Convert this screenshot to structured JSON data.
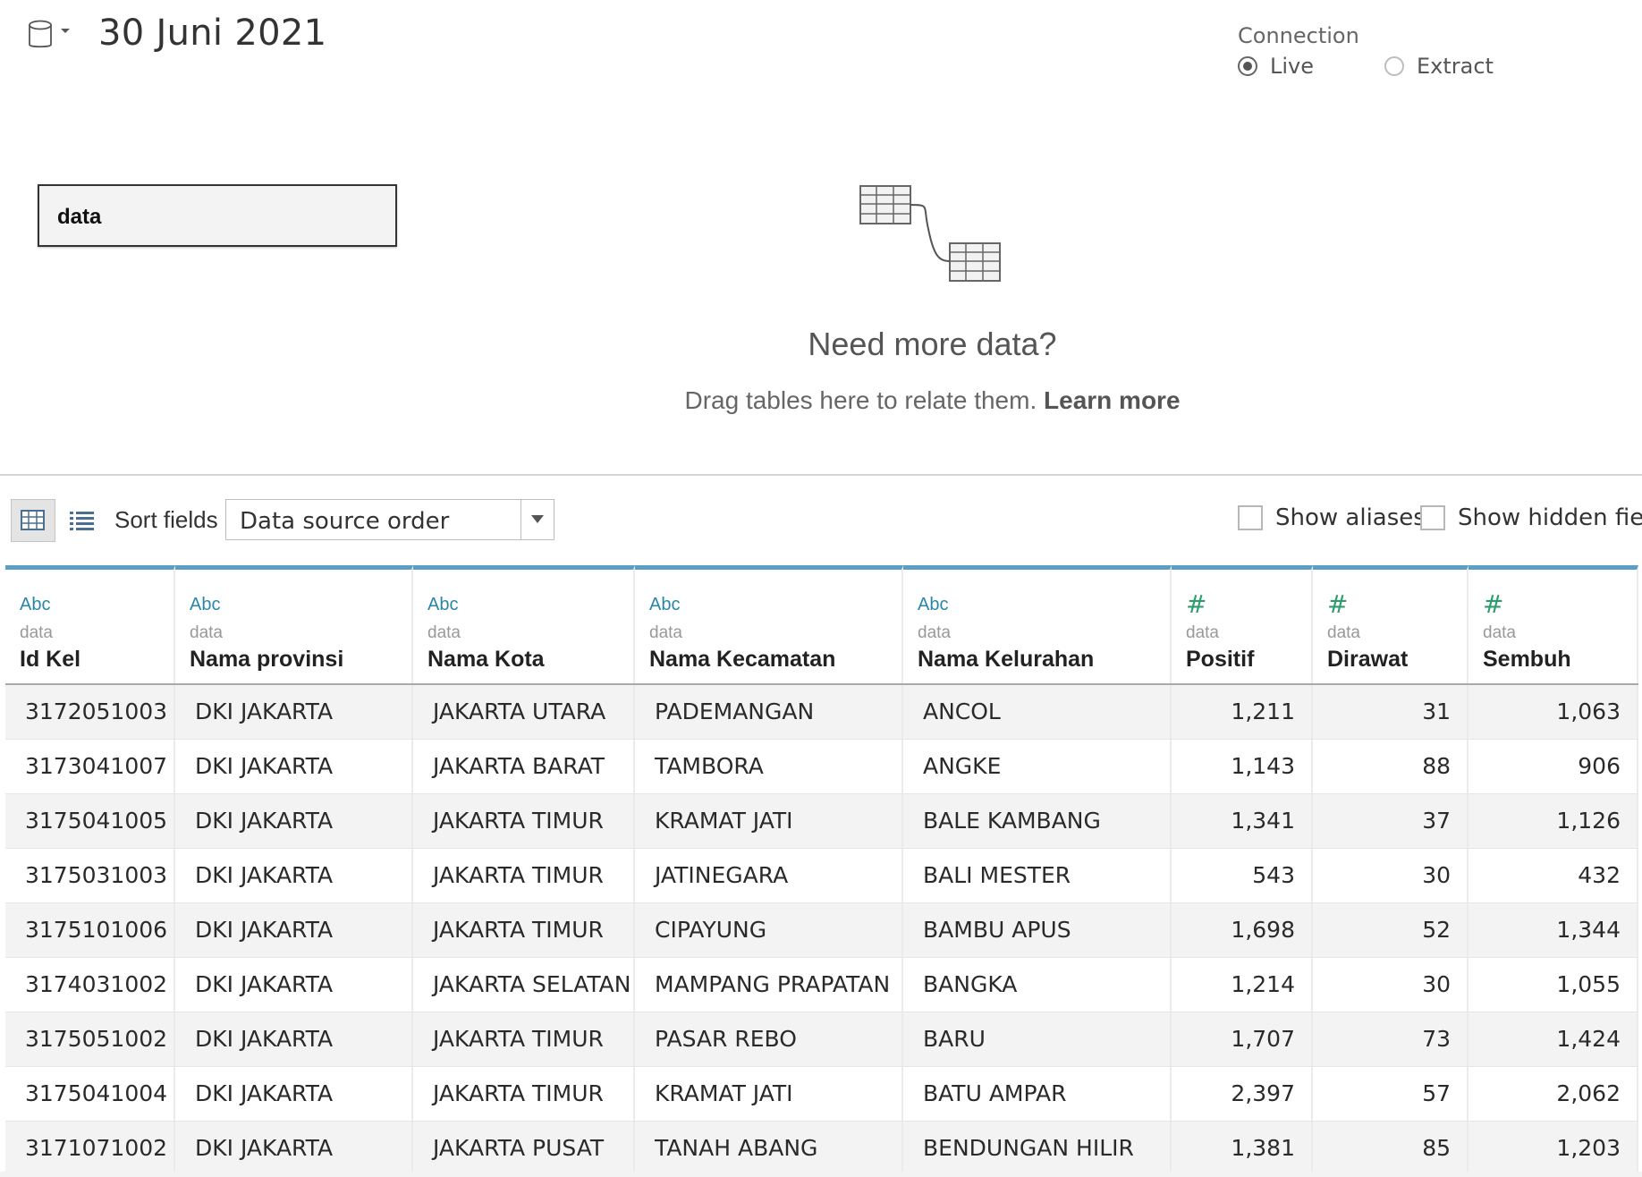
{
  "datasource": {
    "title": "30 Juni 2021",
    "icon": "database-icon"
  },
  "connection": {
    "label": "Connection",
    "options": [
      {
        "label": "Live",
        "selected": true
      },
      {
        "label": "Extract",
        "selected": false
      }
    ]
  },
  "canvas": {
    "table_name": "data",
    "need_more_title": "Need more data?",
    "need_more_text": "Drag tables here to relate them.",
    "learn_more": "Learn more"
  },
  "toolbar": {
    "sort_label": "Sort fields",
    "sort_value": "Data source order",
    "show_aliases": "Show aliases",
    "show_hidden": "Show hidden fields"
  },
  "grid": {
    "columns": [
      {
        "type": "Abc",
        "source": "data",
        "name": "Id Kel"
      },
      {
        "type": "Abc",
        "source": "data",
        "name": "Nama provinsi"
      },
      {
        "type": "Abc",
        "source": "data",
        "name": "Nama Kota"
      },
      {
        "type": "Abc",
        "source": "data",
        "name": "Nama Kecamatan"
      },
      {
        "type": "Abc",
        "source": "data",
        "name": "Nama Kelurahan"
      },
      {
        "type": "#",
        "source": "data",
        "name": "Positif"
      },
      {
        "type": "#",
        "source": "data",
        "name": "Dirawat"
      },
      {
        "type": "#",
        "source": "data",
        "name": "Sembuh"
      }
    ],
    "rows": [
      [
        "3172051003",
        "DKI JAKARTA",
        "JAKARTA UTARA",
        "PADEMANGAN",
        "ANCOL",
        "1,211",
        "31",
        "1,063"
      ],
      [
        "3173041007",
        "DKI JAKARTA",
        "JAKARTA BARAT",
        "TAMBORA",
        "ANGKE",
        "1,143",
        "88",
        "906"
      ],
      [
        "3175041005",
        "DKI JAKARTA",
        "JAKARTA TIMUR",
        "KRAMAT JATI",
        "BALE KAMBANG",
        "1,341",
        "37",
        "1,126"
      ],
      [
        "3175031003",
        "DKI JAKARTA",
        "JAKARTA TIMUR",
        "JATINEGARA",
        "BALI MESTER",
        "543",
        "30",
        "432"
      ],
      [
        "3175101006",
        "DKI JAKARTA",
        "JAKARTA TIMUR",
        "CIPAYUNG",
        "BAMBU APUS",
        "1,698",
        "52",
        "1,344"
      ],
      [
        "3174031002",
        "DKI JAKARTA",
        "JAKARTA SELATAN",
        "MAMPANG PRAPATAN",
        "BANGKA",
        "1,214",
        "30",
        "1,055"
      ],
      [
        "3175051002",
        "DKI JAKARTA",
        "JAKARTA TIMUR",
        "PASAR REBO",
        "BARU",
        "1,707",
        "73",
        "1,424"
      ],
      [
        "3175041004",
        "DKI JAKARTA",
        "JAKARTA TIMUR",
        "KRAMAT JATI",
        "BATU AMPAR",
        "2,397",
        "57",
        "2,062"
      ],
      [
        "3171071002",
        "DKI JAKARTA",
        "JAKARTA PUSAT",
        "TANAH ABANG",
        "BENDUNGAN HILIR",
        "1,381",
        "85",
        "1,203"
      ]
    ]
  }
}
